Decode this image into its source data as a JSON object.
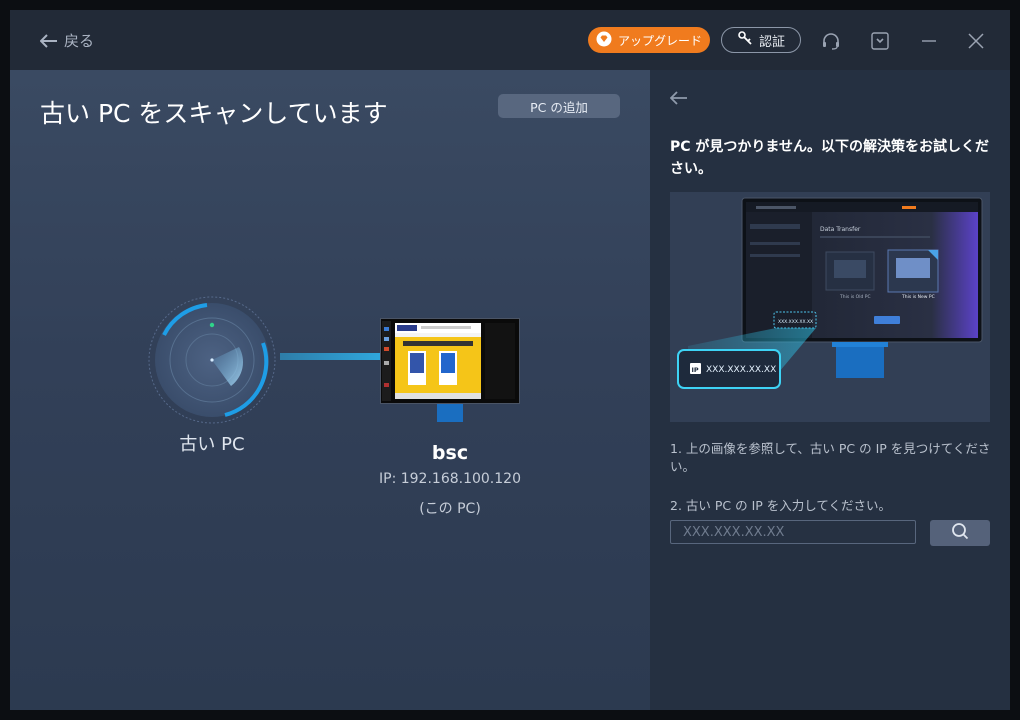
{
  "titlebar": {
    "back_label": "戻る",
    "upgrade_label": "アップグレード",
    "auth_label": "認証"
  },
  "left": {
    "title": "古い PC をスキャンしています",
    "add_pc_label": "PC の追加",
    "old_pc_label": "古い PC",
    "found_pc": {
      "name": "bsc",
      "ip": "IP: 192.168.100.120",
      "note": "(この PC)"
    }
  },
  "right": {
    "heading": "PC が見つかりません。以下の解決策をお試しください。",
    "illustration": {
      "app_title": "Data Transfer",
      "old_pc_card": "This is Old PC",
      "new_pc_card": "This is New PC",
      "ip_sample": "XXX.XXX.XX.XX",
      "ip_badge": "IP"
    },
    "step1": "1. 上の画像を参照して、古い PC の IP を見つけてください。",
    "step2": "2. 古い PC の IP を入力してください。",
    "ip_placeholder": "XXX.XXX.XX.XX"
  },
  "colors": {
    "accent_blue": "#1e9de6",
    "upgrade_orange": "#f07b1e",
    "panel_right": "#253041"
  },
  "icons": [
    "arrow-left-icon",
    "diamond-icon",
    "key-icon",
    "headset-icon",
    "download-icon",
    "minimize-icon",
    "close-icon",
    "search-icon",
    "radar-icon",
    "monitor-icon"
  ]
}
